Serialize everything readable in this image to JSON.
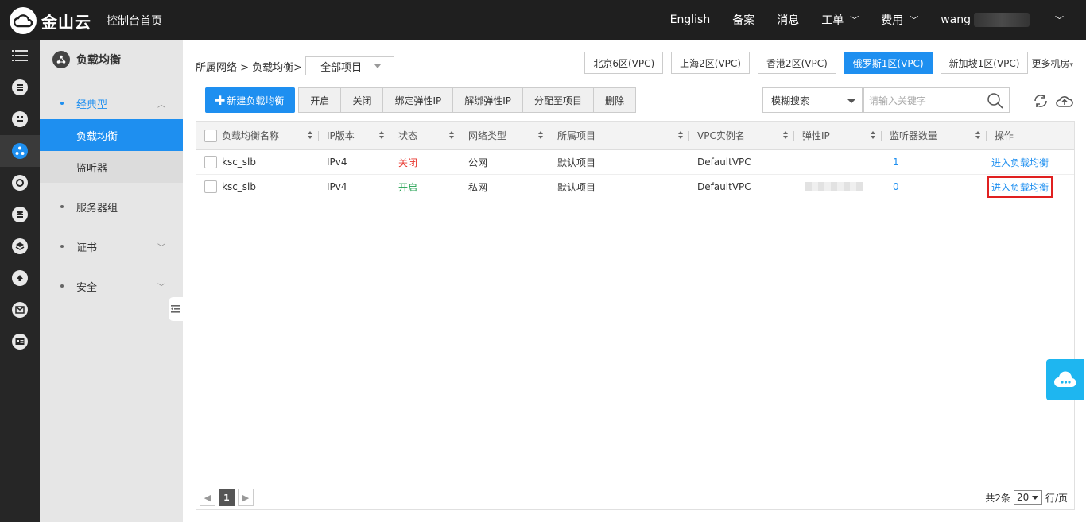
{
  "brand": {
    "logo_text": "金山云",
    "home_link": "控制台首页"
  },
  "topnav": {
    "english": "English",
    "filing": "备案",
    "messages": "消息",
    "tickets": "工单",
    "billing": "费用",
    "user": "wang"
  },
  "sidebar": {
    "title": "负载均衡",
    "groups": [
      {
        "label": "经典型",
        "open": true,
        "items": [
          {
            "label": "负载均衡",
            "active": true
          },
          {
            "label": "监听器",
            "active": false
          }
        ]
      },
      {
        "label": "服务器组"
      },
      {
        "label": "证书"
      },
      {
        "label": "安全"
      }
    ]
  },
  "breadcrumb": {
    "text": "所属网络 > 负载均衡>",
    "project_select": "全部项目"
  },
  "regions": {
    "items": [
      "北京6区(VPC)",
      "上海2区(VPC)",
      "香港2区(VPC)",
      "俄罗斯1区(VPC)",
      "新加坡1区(VPC)"
    ],
    "active_index": 3,
    "more": "更多机房"
  },
  "toolbar": {
    "create": "新建负载均衡",
    "buttons": [
      "开启",
      "关闭",
      "绑定弹性IP",
      "解绑弹性IP",
      "分配至项目",
      "删除"
    ]
  },
  "search": {
    "mode": "模糊搜索",
    "placeholder": "请输入关键字"
  },
  "table": {
    "columns": [
      "负载均衡名称",
      "IP版本",
      "状态",
      "网络类型",
      "所属项目",
      "VPC实例名",
      "弹性IP",
      "监听器数量",
      "操作"
    ],
    "rows": [
      {
        "name": "ksc_slb",
        "ip_version": "IPv4",
        "status": "关闭",
        "network": "公网",
        "project": "默认项目",
        "vpc": "DefaultVPC",
        "eip": "",
        "listeners": "1",
        "action": "进入负载均衡"
      },
      {
        "name": "ksc_slb",
        "ip_version": "IPv4",
        "status": "开启",
        "network": "私网",
        "project": "默认项目",
        "vpc": "DefaultVPC",
        "eip": "",
        "listeners": "0",
        "action": "进入负载均衡"
      }
    ]
  },
  "pager": {
    "current_page": "1",
    "total": "共2条",
    "page_size": "20",
    "per_page": "行/页"
  },
  "colors": {
    "accent": "#1e8ff0",
    "status_off": "#e8372e",
    "status_on": "#21a150",
    "highlight": "#e02020"
  }
}
